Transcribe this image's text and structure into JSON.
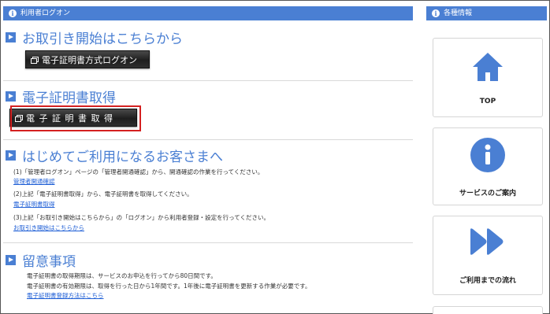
{
  "left_bar": {
    "title": "利用者ログオン"
  },
  "right_bar": {
    "title": "各種情報"
  },
  "sections": {
    "trading_start": {
      "heading": "お取引き開始はこちらから",
      "button": "電子証明書方式ログオン"
    },
    "certificate": {
      "heading": "電子証明書取得",
      "button": "電 子 証 明 書 取 得"
    },
    "first_time": {
      "heading": "はじめてご利用になるお客さまへ",
      "steps": [
        {
          "text": "(1)「管理者ログオン」ページの「管理者開通確認」から、開通確認の作業を行ってください。",
          "link": "管理者開通確認"
        },
        {
          "text": "(2)上記「電子証明書取得」から、電子証明書を取得してください。",
          "link": "電子証明書取得"
        },
        {
          "text": "(3)上記「お取引き開始はこちらから」の「ログオン」から利用者登録・設定を行ってください。",
          "link": "お取引き開始はこちらから"
        }
      ]
    },
    "notes": {
      "heading": "留意事項",
      "lines": [
        "電子証明書の取得期限は、サービスのお申込を行ってから80日間です。",
        "電子証明書の有効期限は、取得を行った日から1年間です。1年後に電子証明書を更新する作業が必要です。"
      ],
      "link": "電子証明書登録方法はこちら"
    }
  },
  "right_cards": [
    {
      "label": "TOP",
      "icon": "home-icon"
    },
    {
      "label": "サービスのご案内",
      "icon": "info-icon"
    },
    {
      "label": "ご利用までの流れ",
      "icon": "fast-forward-icon"
    }
  ],
  "colors": {
    "accent": "#4a7fd3",
    "highlight": "#d42020",
    "link": "#1f5fd6"
  }
}
